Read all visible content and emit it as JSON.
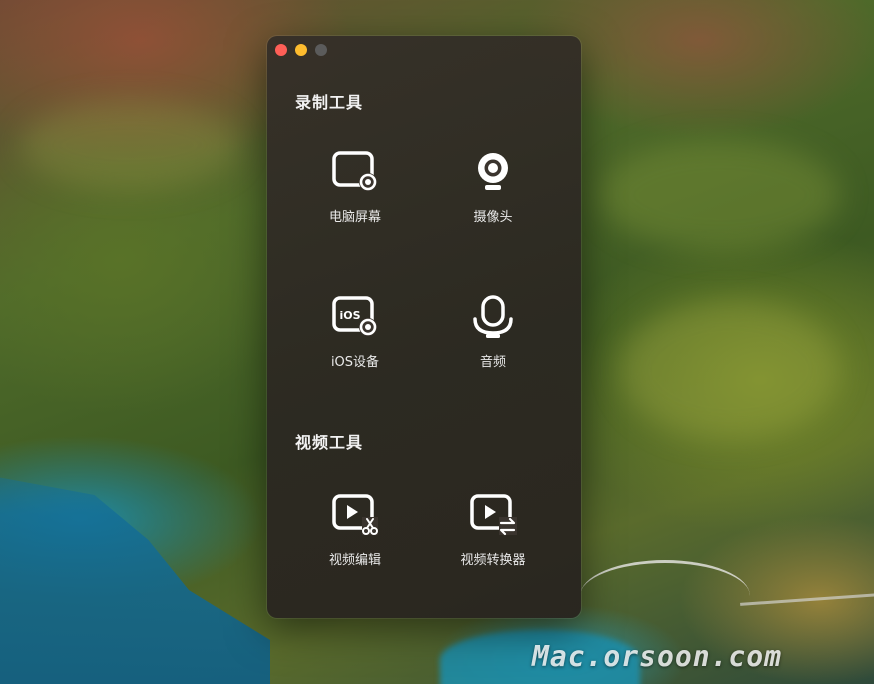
{
  "window": {
    "sections": [
      {
        "title": "录制工具",
        "tools": [
          {
            "label": "电脑屏幕",
            "icon": "screen-record-icon"
          },
          {
            "label": "摄像头",
            "icon": "webcam-icon"
          },
          {
            "label": "iOS设备",
            "icon": "ios-device-icon",
            "icon_text": "iOS"
          },
          {
            "label": "音频",
            "icon": "microphone-icon"
          }
        ]
      },
      {
        "title": "视频工具",
        "tools": [
          {
            "label": "视频编辑",
            "icon": "video-edit-icon"
          },
          {
            "label": "视频转换器",
            "icon": "video-convert-icon"
          }
        ]
      }
    ]
  },
  "watermark": "Mac.orsoon.com",
  "colors": {
    "close": "#ff5f57",
    "minimize": "#febc2e",
    "maximize": "#5b5b5b",
    "icon": "#ffffff",
    "text": "#e9e9e9"
  }
}
